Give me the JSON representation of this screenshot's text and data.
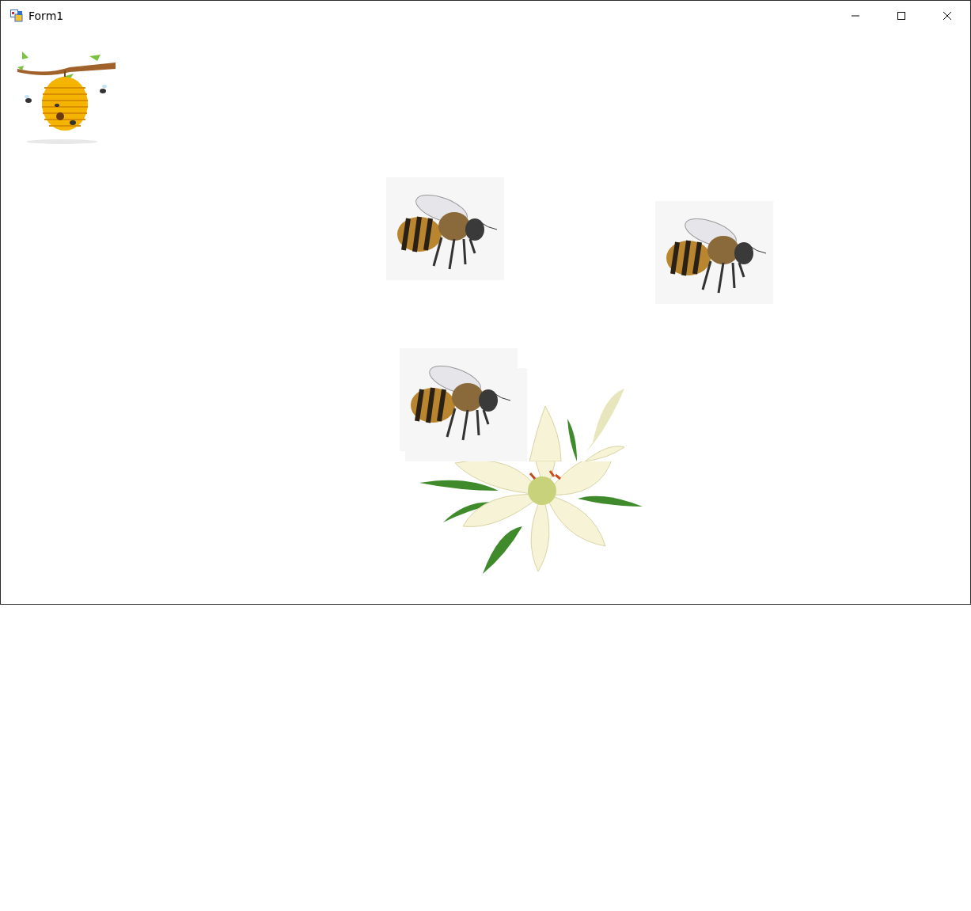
{
  "window": {
    "title": "Form1"
  }
}
